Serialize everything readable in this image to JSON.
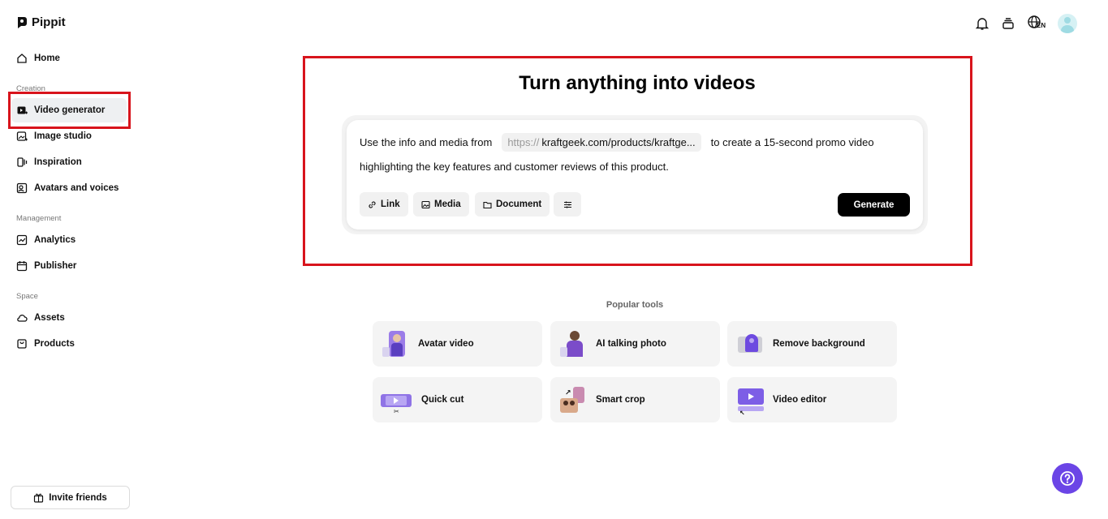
{
  "app": {
    "name": "Pippit"
  },
  "sidebar": {
    "home": "Home",
    "sections": {
      "creation": "Creation",
      "management": "Management",
      "space": "Space"
    },
    "items": {
      "video_generator": "Video generator",
      "image_studio": "Image studio",
      "inspiration": "Inspiration",
      "avatars_voices": "Avatars and voices",
      "analytics": "Analytics",
      "publisher": "Publisher",
      "assets": "Assets",
      "products": "Products"
    },
    "active_item": "Video generator",
    "invite": "Invite friends"
  },
  "topbar": {
    "language": "EN",
    "icons": [
      "bell-icon",
      "layers-icon",
      "globe-icon",
      "avatar"
    ]
  },
  "hero": {
    "title": "Turn anything into videos",
    "prompt": {
      "prefix": "Use the info and media from",
      "url_scheme": "https://",
      "url_text": "kraftgeek.com/products/kraftge...",
      "suffix": "to create a 15-second promo video",
      "line2": "highlighting the key features and customer reviews of this product."
    },
    "buttons": {
      "link": "Link",
      "media": "Media",
      "document": "Document",
      "generate": "Generate"
    }
  },
  "popular": {
    "label": "Popular tools",
    "tools": [
      {
        "label": "Avatar video"
      },
      {
        "label": "AI talking photo"
      },
      {
        "label": "Remove background"
      },
      {
        "label": "Quick cut"
      },
      {
        "label": "Smart crop"
      },
      {
        "label": "Video editor"
      }
    ]
  },
  "colors": {
    "accent": "#6b45e6",
    "annotation_red": "#d8141c",
    "primary_button": "#000000"
  }
}
